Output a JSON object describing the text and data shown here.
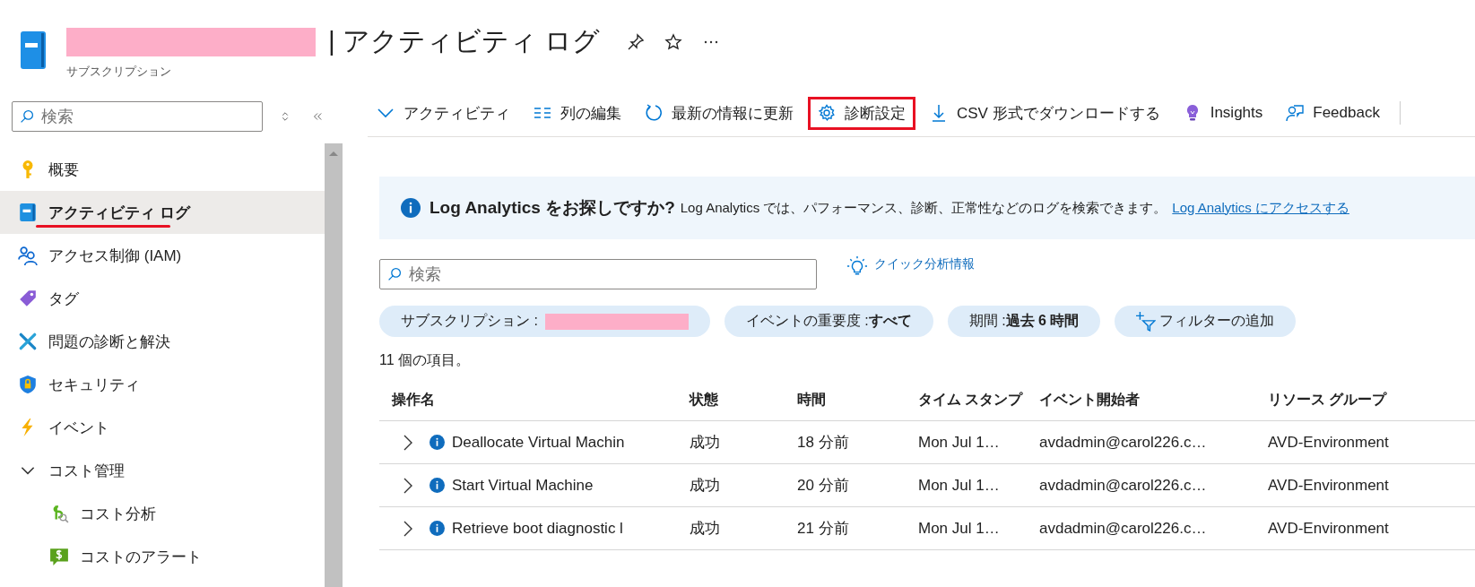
{
  "header": {
    "name_redacted": true,
    "title": "| アクティビティ ログ",
    "subtitle": "サブスクリプション"
  },
  "sidebar": {
    "search": {
      "placeholder": "検索"
    },
    "items": [
      {
        "label": "概要",
        "selected": false,
        "underlined": false
      },
      {
        "label": "アクティビティ ログ",
        "selected": true,
        "underlined": true
      },
      {
        "label": "アクセス制御 (IAM)",
        "selected": false,
        "underlined": false
      },
      {
        "label": "タグ",
        "selected": false,
        "underlined": false
      },
      {
        "label": "問題の診断と解決",
        "selected": false,
        "underlined": false
      },
      {
        "label": "セキュリティ",
        "selected": false,
        "underlined": false
      },
      {
        "label": "イベント",
        "selected": false,
        "underlined": false
      },
      {
        "label": "コスト管理",
        "selected": false,
        "underlined": false,
        "expanded": true,
        "children": [
          {
            "label": "コスト分析",
            "selected": false,
            "underlined": false
          },
          {
            "label": "コストのアラート",
            "selected": false,
            "underlined": false
          }
        ]
      }
    ]
  },
  "toolbar": [
    {
      "label": "アクティビティ",
      "highlighted": false
    },
    {
      "label": "列の編集",
      "highlighted": false
    },
    {
      "label": "最新の情報に更新",
      "highlighted": false
    },
    {
      "label": "診断設定",
      "highlighted": true
    },
    {
      "label": "CSV 形式でダウンロードする",
      "highlighted": false
    },
    {
      "label": "Insights",
      "highlighted": false
    },
    {
      "label": "Feedback",
      "highlighted": false
    }
  ],
  "banner": {
    "title": "Log Analytics をお探しですか?",
    "text": "Log Analytics では、パフォーマンス、診断、正常性などのログを検索できます。",
    "link": "Log Analytics にアクセスする"
  },
  "search": {
    "placeholder": "検索"
  },
  "quick_insights": "クイック分析情報",
  "filters": [
    {
      "kind": "filter",
      "label": "サブスクリプション :",
      "redacted": true
    },
    {
      "kind": "filter",
      "label": "イベントの重要度 :",
      "value": "すべて"
    },
    {
      "kind": "filter",
      "label": "期間 :",
      "value": "過去 6 時間"
    },
    {
      "kind": "add",
      "label": "フィルターの追加"
    }
  ],
  "count": "11 個の項目。",
  "table": {
    "columns": [
      "操作名",
      "状態",
      "時間",
      "タイム スタンプ",
      "イベント開始者",
      "リソース グループ"
    ],
    "rows": [
      {
        "expanded": false,
        "cells": [
          "Deallocate Virtual Machin",
          "成功",
          "18 分前",
          "Mon Jul 1…",
          "avdadmin@carol226.c…",
          "AVD-Environment"
        ]
      },
      {
        "expanded": false,
        "cells": [
          "Start Virtual Machine",
          "成功",
          "20 分前",
          "Mon Jul 1…",
          "avdadmin@carol226.c…",
          "AVD-Environment"
        ]
      },
      {
        "expanded": false,
        "cells": [
          "Retrieve boot diagnostic l",
          "成功",
          "21 分前",
          "Mon Jul 1…",
          "avdadmin@carol226.c…",
          "AVD-Environment"
        ]
      }
    ]
  }
}
